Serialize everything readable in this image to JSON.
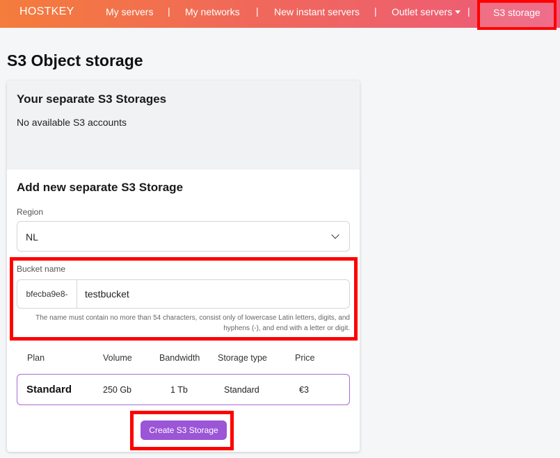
{
  "nav": {
    "brand": "HOSTKEY",
    "items": [
      "My servers",
      "My networks",
      "New instant servers",
      "Outlet servers"
    ],
    "separator": "|",
    "active": "S3 storage"
  },
  "page": {
    "title": "S3 Object storage"
  },
  "existing": {
    "title": "Your separate S3 Storages",
    "empty_text": "No available S3 accounts"
  },
  "form": {
    "title": "Add new separate S3 Storage",
    "region_label": "Region",
    "region_value": "NL",
    "bucket_label": "Bucket name",
    "bucket_prefix": "bfecba9e8-",
    "bucket_value": "testbucket",
    "bucket_hint": "The name must contain no more than 54 characters, consist only of lowercase Latin letters, digits, and hyphens (-), and end with a letter or digit."
  },
  "plans": {
    "headers": [
      "Plan",
      "Volume",
      "Bandwidth",
      "Storage type",
      "Price"
    ],
    "rows": [
      {
        "plan": "Standard",
        "volume": "250 Gb",
        "bandwidth": "1 Tb",
        "storage_type": "Standard",
        "price": "€3"
      }
    ]
  },
  "actions": {
    "create_label": "Create S3 Storage"
  },
  "colors": {
    "accent": "#9b55d6",
    "highlight": "#ff0000",
    "nav_start": "#f47c3c",
    "nav_end": "#ec5a7c"
  }
}
